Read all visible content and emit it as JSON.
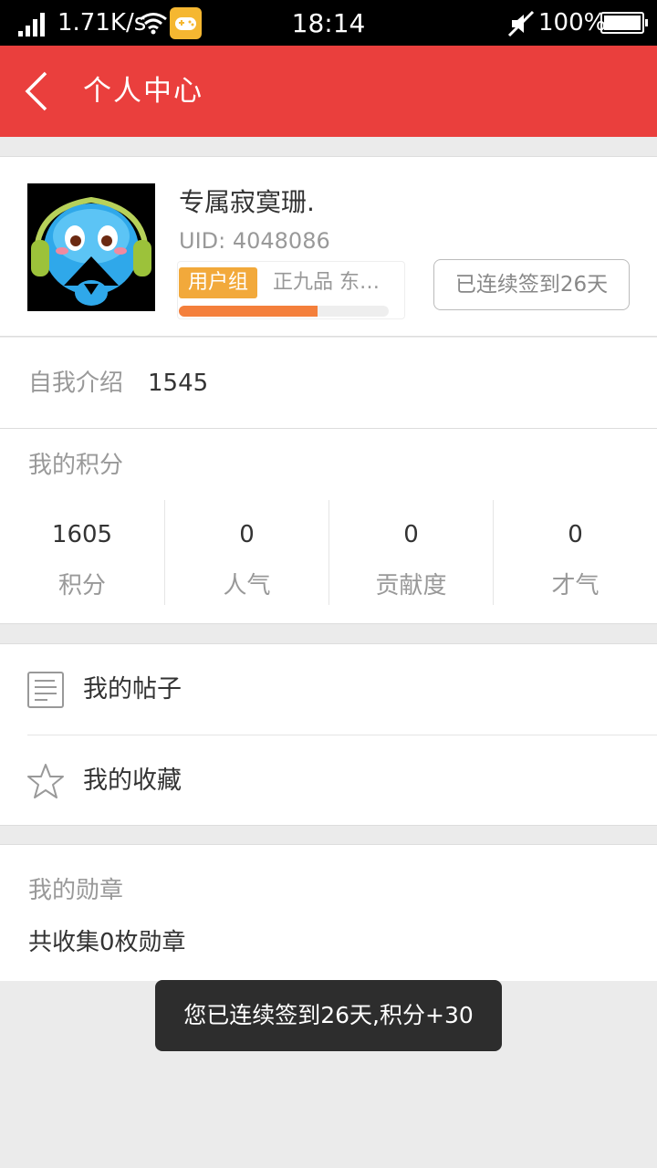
{
  "status_bar": {
    "speed": "1.71K/s",
    "time": "18:14",
    "battery": "100%",
    "icons": [
      "signal-icon",
      "wifi-icon",
      "game-icon",
      "mute-icon",
      "battery-icon"
    ]
  },
  "header": {
    "title": "个人中心",
    "back_icon": "chevron-left-icon",
    "color": "#ea3f3d"
  },
  "profile": {
    "username": "专属寂寞珊.",
    "uid": "UID: 4048086",
    "group_tag": "用户组",
    "group_rank": "正九品 东…",
    "level_progress": 0.66,
    "sign_button": "已连续签到26天"
  },
  "intro": {
    "label": "自我介绍",
    "value": "1545"
  },
  "points": {
    "label": "我的积分",
    "stats": [
      {
        "value": "1605",
        "label": "积分"
      },
      {
        "value": "0",
        "label": "人气"
      },
      {
        "value": "0",
        "label": "贡献度"
      },
      {
        "value": "0",
        "label": "才气"
      }
    ]
  },
  "menu": {
    "posts": "我的帖子",
    "favorites": "我的收藏"
  },
  "medals": {
    "label": "我的勋章",
    "count_text": "共收集0枚勋章"
  },
  "toast": {
    "text": "您已连续签到26天,积分+30"
  }
}
